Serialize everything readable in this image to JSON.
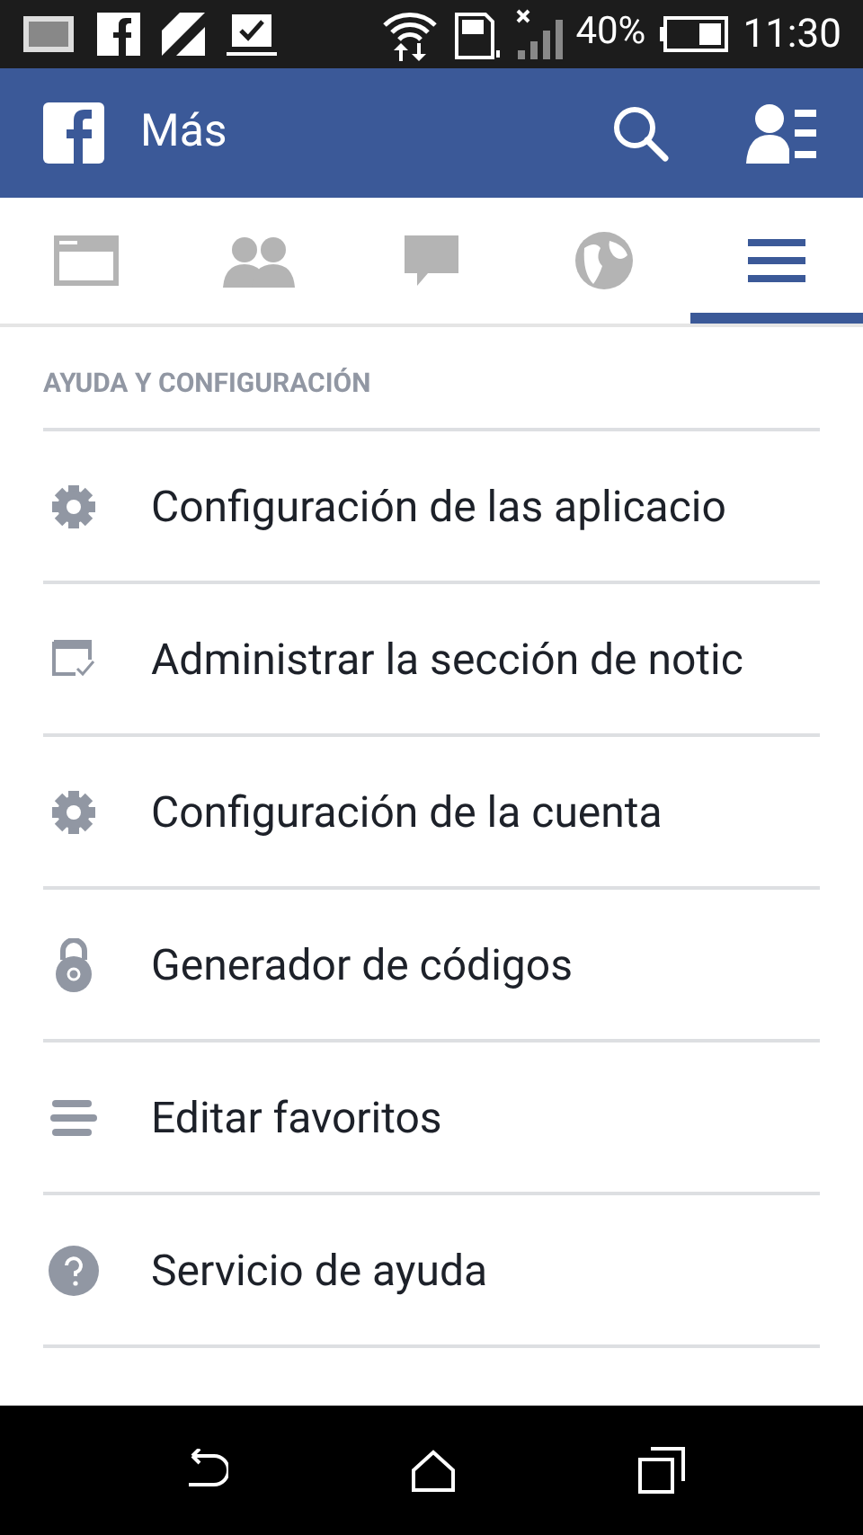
{
  "status_bar": {
    "battery": "40%",
    "time": "11:30"
  },
  "header": {
    "title": "Más"
  },
  "tabs": [
    {
      "kind": "feed",
      "selected": false
    },
    {
      "kind": "friends",
      "selected": false
    },
    {
      "kind": "messages",
      "selected": false
    },
    {
      "kind": "globe",
      "selected": false
    },
    {
      "kind": "menu",
      "selected": true
    }
  ],
  "section": {
    "heading": "AYUDA Y CONFIGURACIÓN",
    "items": [
      {
        "kind": "gear",
        "label": "Configuración de las aplicacio"
      },
      {
        "kind": "feed",
        "label": "Administrar la sección de notic"
      },
      {
        "kind": "gear",
        "label": "Configuración de la cuenta"
      },
      {
        "kind": "lock",
        "label": "Generador de códigos"
      },
      {
        "kind": "lines",
        "label": "Editar favoritos"
      },
      {
        "kind": "help",
        "label": "Servicio de ayuda"
      }
    ]
  }
}
